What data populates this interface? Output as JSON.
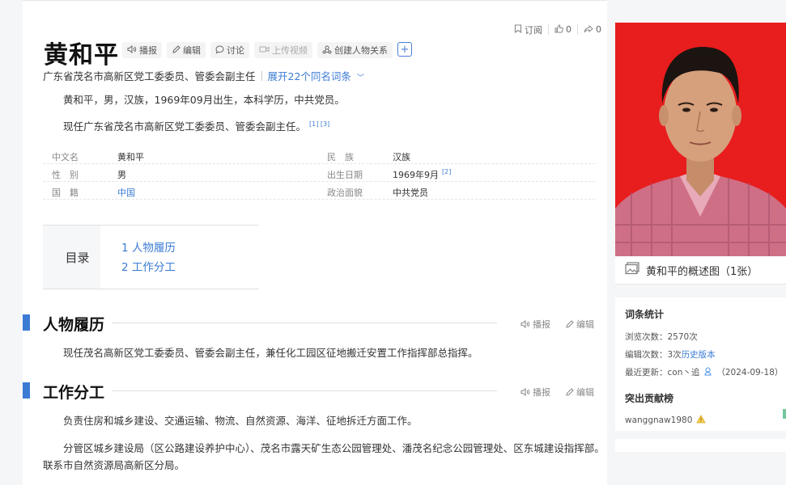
{
  "topbar": {
    "subscribe_label": "订阅",
    "like_count": "0",
    "share_count": "0"
  },
  "entry": {
    "title": "黄和平",
    "actions": {
      "broadcast": "播报",
      "edit": "编辑",
      "discuss": "讨论",
      "upload_video": "上传视频",
      "create_relation": "创建人物关系"
    },
    "subtitle": "广东省茂名市高新区党工委委员、管委会副主任",
    "more_same_name": "展开22个同名词条",
    "summary_1": "黄和平，男，汉族，1969年09月出生，本科学历，中共党员。",
    "summary_2": "现任广东省茂名市高新区党工委委员、管委会副主任。",
    "summary_2_refs": "[1] [3]"
  },
  "infobox": {
    "rows": [
      {
        "k1": "中文名",
        "v1": "黄和平",
        "k2": "民　族",
        "v2": "汉族",
        "ref2": ""
      },
      {
        "k1": "性　别",
        "v1": "男",
        "k2": "出生日期",
        "v2": "1969年9月",
        "ref2": "[2]"
      },
      {
        "k1": "国　籍",
        "v1": "中国",
        "k2": "政治面貌",
        "v2": "中共党员",
        "ref2": ""
      }
    ]
  },
  "toc": {
    "label": "目录",
    "items": [
      "1  人物履历",
      "2  工作分工"
    ]
  },
  "sections": {
    "s1_title": "人物履历",
    "s1_text": "现任茂名高新区党工委委员、管委会副主任，兼任化工园区征地搬迁安置工作指挥部总指挥。",
    "s2_title": "工作分工",
    "s2_text_1": "负责住房和城乡建设、交通运输、物流、自然资源、海洋、征地拆迁方面工作。",
    "s2_text_2": "分管区城乡建设局（区公路建设养护中心）、茂名市露天矿生态公园管理处、潘茂名纪念公园管理处、区东城建设指挥部。",
    "s2_text_3": "联系市自然资源局高新区分局。",
    "broadcast": "播报",
    "edit": "编辑"
  },
  "sidebar": {
    "photo_caption": "黄和平的概述图（1张）",
    "stats_title": "词条统计",
    "views": "浏览次数：2570次",
    "edits_prefix": "编辑次数：3次",
    "history_link": "历史版本",
    "last_update_prefix": "最近更新：con丶追",
    "last_update_date": "（2024-09-18）",
    "contrib_title": "突出贡献榜",
    "contributor": "wanggnaw1980"
  },
  "colors": {
    "accent": "#3b7bd4",
    "photo_bg": "#e81d1d"
  }
}
